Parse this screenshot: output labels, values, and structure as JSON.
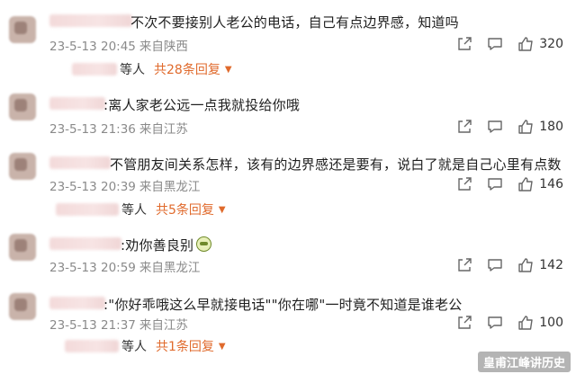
{
  "comments": [
    {
      "text": "不次不要接别人老公的电话，自己有点边界感，知道吗",
      "date": "23-5-13 20:45",
      "location": "来自陕西",
      "likes": "320",
      "reply_user": "等人",
      "reply_link": "共28条回复"
    },
    {
      "text": ":离人家老公远一点我就投给你哦",
      "date": "23-5-13 21:36",
      "location": "来自江苏",
      "likes": "180"
    },
    {
      "text": "不管朋友间关系怎样，该有的边界感还是要有，说白了就是自己心里有点数",
      "date": "23-5-13 20:39",
      "location": "来自黑龙江",
      "likes": "146",
      "reply_user": "等人",
      "reply_link": "共5条回复"
    },
    {
      "text": ":劝你善良别",
      "date": "23-5-13 20:59",
      "location": "来自黑龙江",
      "likes": "142"
    },
    {
      "text": ":\"你好乖哦这么早就接电话\"\"你在哪\"一时竟不知道是谁老公",
      "date": "23-5-13 21:37",
      "location": "来自江苏",
      "likes": "100",
      "reply_user": "等人",
      "reply_link": "共1条回复"
    }
  ],
  "icons": {
    "share": "share-icon",
    "comment": "comment-icon",
    "like": "like-icon"
  },
  "accent_color": "#e06a2c",
  "watermark": "皇甫江峰讲历史"
}
